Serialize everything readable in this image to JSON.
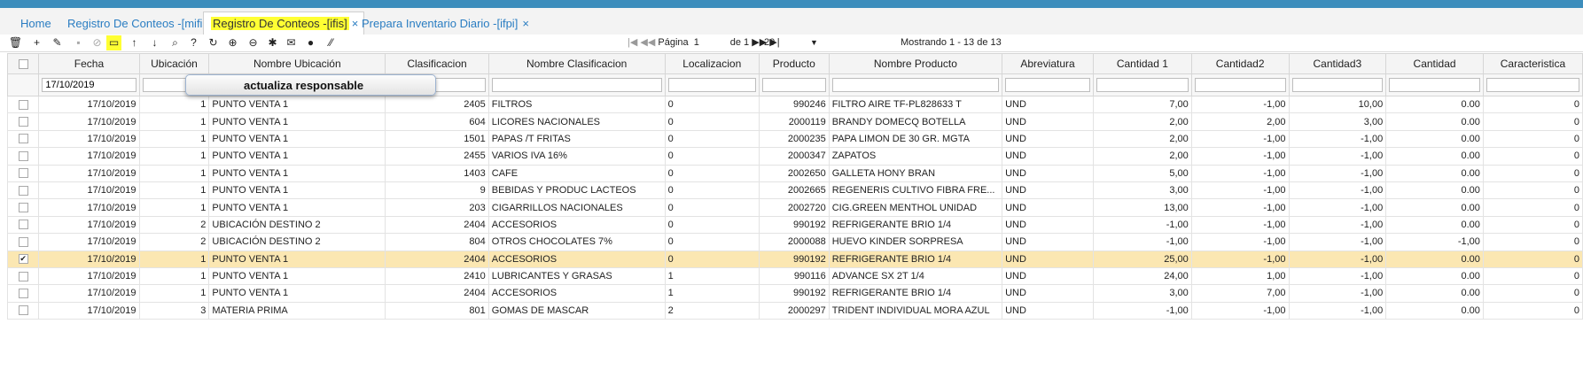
{
  "tabs": [
    {
      "label": "Home",
      "active": false,
      "closable": false
    },
    {
      "label": "Registro De Conteos -[mifis]",
      "active": false,
      "closable": true
    },
    {
      "label": "Registro De Conteos -[ifis]",
      "active": true,
      "closable": true
    },
    {
      "label": "Prepara Inventario Diario -[ifpi]",
      "active": false,
      "closable": true
    }
  ],
  "close_glyph": "×",
  "toolbar": {
    "icons": [
      {
        "name": "delete-icon",
        "glyph": "🗑",
        "disabled": false
      },
      {
        "name": "add-icon",
        "glyph": "+",
        "disabled": false
      },
      {
        "name": "edit-icon",
        "glyph": "✎",
        "disabled": false
      },
      {
        "name": "save-icon",
        "glyph": "▪",
        "disabled": true
      },
      {
        "name": "cancel-icon",
        "glyph": "⊘",
        "disabled": true
      },
      {
        "name": "responsible-icon",
        "glyph": "▭",
        "disabled": false,
        "highlight": true
      },
      {
        "name": "move-up-icon",
        "glyph": "↑",
        "disabled": false
      },
      {
        "name": "move-down-icon",
        "glyph": "↓",
        "disabled": false
      },
      {
        "name": "search-icon",
        "glyph": "⌕",
        "disabled": false
      },
      {
        "name": "help-icon",
        "glyph": "?",
        "disabled": false
      },
      {
        "name": "refresh-icon",
        "glyph": "↻",
        "disabled": false
      },
      {
        "name": "zoom-in-icon",
        "glyph": "⊕",
        "disabled": false
      },
      {
        "name": "zoom-out-icon",
        "glyph": "⊖",
        "disabled": false
      },
      {
        "name": "pin-icon",
        "glyph": "✱",
        "disabled": false
      },
      {
        "name": "mail-icon",
        "glyph": "✉",
        "disabled": false
      },
      {
        "name": "plus-circle-icon",
        "glyph": "●",
        "disabled": false
      },
      {
        "name": "resize-icon",
        "glyph": "⁄⁄",
        "disabled": false
      }
    ]
  },
  "pager": {
    "first_glyph": "|◀",
    "prev_glyph": "◀◀",
    "page_label": "Página",
    "page_value": "1",
    "of_label": "de 1",
    "next_glyph": "▶▶",
    "last_glyph": "▶|",
    "page_size": "20",
    "showing": "Mostrando 1 - 13 de 13"
  },
  "columns": [
    "",
    "Fecha",
    "Ubicación",
    "Nombre Ubicación",
    "Clasificacion",
    "Nombre Clasificacion",
    "Localizacion",
    "Producto",
    "Nombre Producto",
    "Abreviatura",
    "Cantidad 1",
    "Cantidad2",
    "Cantidad3",
    "Cantidad",
    "Caracteristica"
  ],
  "filters": {
    "fecha": "17/10/2019"
  },
  "tooltip": "actualiza responsable",
  "check_glyph": "✔",
  "rows": [
    {
      "selected": false,
      "cells": [
        "17/10/2019",
        "1",
        "PUNTO VENTA 1",
        "2405",
        "FILTROS",
        "0",
        "990246",
        "FILTRO AIRE TF-PL828633 T",
        "UND",
        "7,00",
        "-1,00",
        "10,00",
        "0.00",
        "0"
      ]
    },
    {
      "selected": false,
      "cells": [
        "17/10/2019",
        "1",
        "PUNTO VENTA 1",
        "604",
        "LICORES NACIONALES",
        "0",
        "2000119",
        "BRANDY DOMECQ BOTELLA",
        "UND",
        "2,00",
        "2,00",
        "3,00",
        "0.00",
        "0"
      ]
    },
    {
      "selected": false,
      "cells": [
        "17/10/2019",
        "1",
        "PUNTO VENTA 1",
        "1501",
        "PAPAS /T FRITAS",
        "0",
        "2000235",
        "PAPA LIMON DE 30 GR. MGTA",
        "UND",
        "2,00",
        "-1,00",
        "-1,00",
        "0.00",
        "0"
      ]
    },
    {
      "selected": false,
      "cells": [
        "17/10/2019",
        "1",
        "PUNTO VENTA 1",
        "2455",
        "VARIOS IVA 16%",
        "0",
        "2000347",
        "ZAPATOS",
        "UND",
        "2,00",
        "-1,00",
        "-1,00",
        "0.00",
        "0"
      ]
    },
    {
      "selected": false,
      "cells": [
        "17/10/2019",
        "1",
        "PUNTO VENTA 1",
        "1403",
        "CAFE",
        "0",
        "2002650",
        "GALLETA HONY BRAN",
        "UND",
        "5,00",
        "-1,00",
        "-1,00",
        "0.00",
        "0"
      ]
    },
    {
      "selected": false,
      "cells": [
        "17/10/2019",
        "1",
        "PUNTO VENTA 1",
        "9",
        "BEBIDAS Y PRODUC LACTEOS",
        "0",
        "2002665",
        "REGENERIS CULTIVO FIBRA FRE...",
        "UND",
        "3,00",
        "-1,00",
        "-1,00",
        "0.00",
        "0"
      ]
    },
    {
      "selected": false,
      "cells": [
        "17/10/2019",
        "1",
        "PUNTO VENTA 1",
        "203",
        "CIGARRILLOS NACIONALES",
        "0",
        "2002720",
        "CIG.GREEN MENTHOL UNIDAD",
        "UND",
        "13,00",
        "-1,00",
        "-1,00",
        "0.00",
        "0"
      ]
    },
    {
      "selected": false,
      "cells": [
        "17/10/2019",
        "2",
        "UBICACIÓN DESTINO 2",
        "2404",
        "ACCESORIOS",
        "0",
        "990192",
        "REFRIGERANTE BRIO 1/4",
        "UND",
        "-1,00",
        "-1,00",
        "-1,00",
        "0.00",
        "0"
      ]
    },
    {
      "selected": false,
      "cells": [
        "17/10/2019",
        "2",
        "UBICACIÓN DESTINO 2",
        "804",
        "OTROS CHOCOLATES 7%",
        "0",
        "2000088",
        "HUEVO KINDER SORPRESA",
        "UND",
        "-1,00",
        "-1,00",
        "-1,00",
        "-1,00",
        "0"
      ]
    },
    {
      "selected": true,
      "cells": [
        "17/10/2019",
        "1",
        "PUNTO VENTA 1",
        "2404",
        "ACCESORIOS",
        "0",
        "990192",
        "REFRIGERANTE BRIO 1/4",
        "UND",
        "25,00",
        "-1,00",
        "-1,00",
        "0.00",
        "0"
      ]
    },
    {
      "selected": false,
      "cells": [
        "17/10/2019",
        "1",
        "PUNTO VENTA 1",
        "2410",
        "LUBRICANTES Y GRASAS",
        "1",
        "990116",
        "ADVANCE SX 2T 1/4",
        "UND",
        "24,00",
        "1,00",
        "-1,00",
        "0.00",
        "0"
      ]
    },
    {
      "selected": false,
      "cells": [
        "17/10/2019",
        "1",
        "PUNTO VENTA 1",
        "2404",
        "ACCESORIOS",
        "1",
        "990192",
        "REFRIGERANTE BRIO 1/4",
        "UND",
        "3,00",
        "7,00",
        "-1,00",
        "0.00",
        "0"
      ]
    },
    {
      "selected": false,
      "cells": [
        "17/10/2019",
        "3",
        "MATERIA PRIMA",
        "801",
        "GOMAS DE MASCAR",
        "2",
        "2000297",
        "TRIDENT INDIVIDUAL MORA AZUL",
        "UND",
        "-1,00",
        "-1,00",
        "-1,00",
        "0.00",
        "0"
      ]
    }
  ]
}
